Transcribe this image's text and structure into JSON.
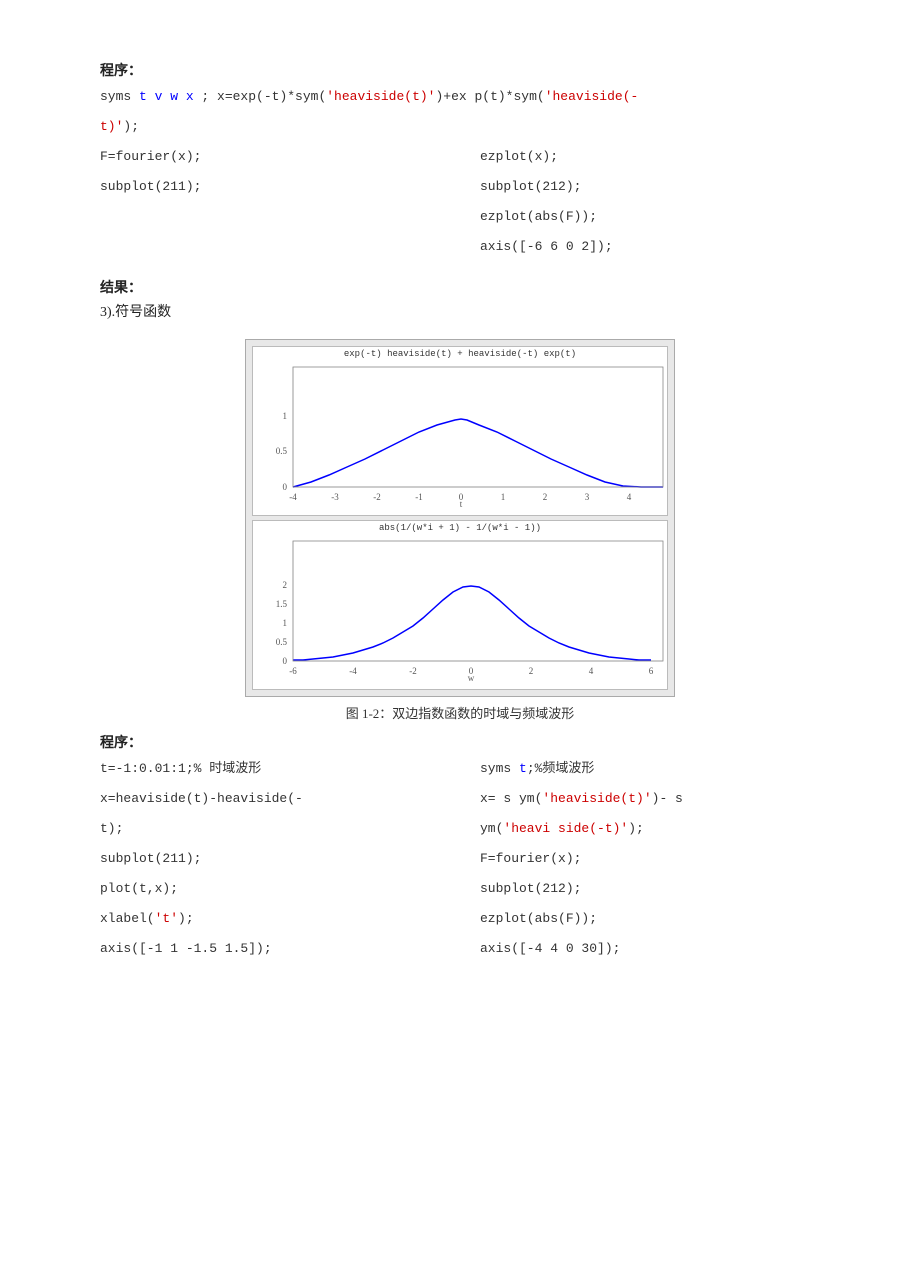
{
  "page": {
    "program_label": "程序：",
    "result_label": "结果：",
    "section3_label": "3).符号函数",
    "figure_caption": "图 1-2：双边指数函数的时域与频域波形",
    "program_label2": "程序：",
    "code_line1": "syms t v w x ; x=exp(-t)*sym('heaviside(t)')+ex p(t)*sym('heaviside(-t)');",
    "code_left": [
      "F=fourier(x);",
      "subplot(211);"
    ],
    "code_right": [
      "ezplot(x);",
      "subplot(212);",
      "ezplot(abs(F));",
      "axis([-6 6 0 2]);"
    ],
    "subplot1_title": "exp(-t) heaviside(t) + heaviside(-t) exp(t)",
    "subplot2_title": "abs(1/(w*i + 1) - 1/(w*i - 1))",
    "subplot1_xlabel": "t",
    "subplot2_xlabel": "w",
    "program2_lines": [
      "t=-1:0.01:1;% 时域波形",
      "x=heaviside(t)-heaviside(-",
      "t);",
      "subplot(211);",
      "plot(t,x);",
      "xlabel('t');",
      "axis([-1 1 -1.5 1.5]);"
    ],
    "program2_lines2": [
      "syms t;%频域波形",
      "x= s ym('heaviside(t)')- s",
      "ym('heavi side(-t)');",
      "F=fourier(x);",
      "subplot(212);",
      "ezplot(abs(F));",
      "axis([-4 4 0 30]);"
    ]
  }
}
